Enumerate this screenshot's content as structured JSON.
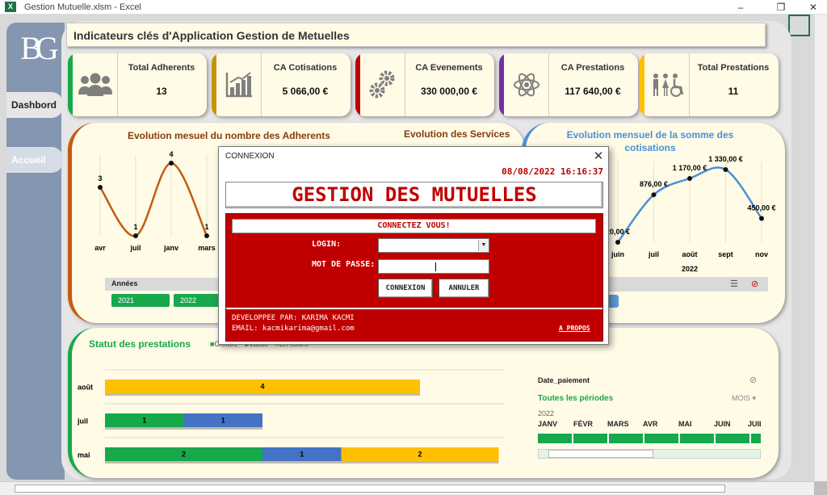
{
  "window": {
    "app_title": "Gestion Mutuelle.xlsm  -  Excel",
    "excel_icon": "X"
  },
  "sidebar": {
    "logo": "BG",
    "tabs": [
      {
        "label": "Dashbord"
      },
      {
        "label": "Accueil"
      }
    ]
  },
  "header": {
    "title": "Indicateurs clés d'Application Gestion de Metuelles"
  },
  "kpis": [
    {
      "label": "Total Adherents",
      "value": "13",
      "color": "#17a84c",
      "icon": "people-icon"
    },
    {
      "label": "CA Cotisations",
      "value": "5 066,00 €",
      "color": "#c8920a",
      "icon": "bar-chart-icon"
    },
    {
      "label": "CA Evenements",
      "value": "330 000,00 €",
      "color": "#c00000",
      "icon": "gears-icon"
    },
    {
      "label": "CA Prestations",
      "value": "117 640,00 €",
      "color": "#7030a0",
      "icon": "atom-icon"
    },
    {
      "label": "Total Prestations",
      "value": "11",
      "color": "#ffc000",
      "icon": "family-icon"
    }
  ],
  "adherents_chart": {
    "title": "Evolution mesuel du nombre des Adherents",
    "slicer_title": "Années",
    "slicer_items": [
      "2021",
      "2022"
    ]
  },
  "chart_data": [
    {
      "type": "line",
      "title": "Evolution mesuel du nombre des Adherents",
      "categories": [
        "avr",
        "juil",
        "janv",
        "mars"
      ],
      "values": [
        3,
        1,
        4,
        1
      ],
      "labels": [
        "3",
        "1",
        "4",
        "1"
      ],
      "color": "#c55a11"
    },
    {
      "type": "line",
      "title": "Evolution mensuel de la somme des cotisations",
      "categories": [
        "juin",
        "juil",
        "août",
        "sept",
        "nov"
      ],
      "values": [
        20,
        876,
        1170,
        1330,
        450
      ],
      "labels": [
        "20,00 €",
        "876,00 €",
        "1 170,00 €",
        "1 330,00 €",
        "450,00 €"
      ],
      "year_label": "2022",
      "color": "#4a90d9"
    },
    {
      "type": "bar",
      "title": "Statut des prestations",
      "categories": [
        "août",
        "juil",
        "mai"
      ],
      "series": [
        {
          "name": "Cloturé",
          "color": "#17a84c",
          "values": [
            0,
            1,
            2
          ]
        },
        {
          "name": "Validé",
          "color": "#4472c4",
          "values": [
            0,
            1,
            1
          ]
        },
        {
          "name": "En cours",
          "color": "#ffc000",
          "values": [
            4,
            0,
            2
          ]
        }
      ]
    }
  ],
  "services_chart": {
    "title": "Evolution des Services"
  },
  "cotisations_chart": {
    "title_line1": "Evolution mensuel de la somme des",
    "title_line2": "cotisations"
  },
  "prestations_chart": {
    "title": "Statut des prestations",
    "legend": [
      "Cloturé",
      "Validé",
      "En cours"
    ]
  },
  "timeline": {
    "field": "Date_paiement",
    "range": "Toutes les périodes",
    "unit": "MOIS",
    "year": "2022",
    "months": [
      "JANV",
      "FÉVR",
      "MARS",
      "AVR",
      "MAI",
      "JUIN",
      "JUIL"
    ]
  },
  "dialog": {
    "title": "CONNEXION",
    "datetime": "08/08/2022 16:16:37",
    "banner": "GESTION DES MUTUELLES",
    "subtitle": "CONNECTEZ VOUS!",
    "login_label": "LOGIN:",
    "login_value": "",
    "password_label": "MOT DE PASSE:",
    "password_value": "",
    "connect_button": "CONNEXION",
    "cancel_button": "ANNULER",
    "dev_line": "DEVELOPPEE PAR: KARIMA KACMI",
    "email_line": "EMAIL: kacmikarima@gmail.com",
    "about_link": "A PROPOS"
  }
}
